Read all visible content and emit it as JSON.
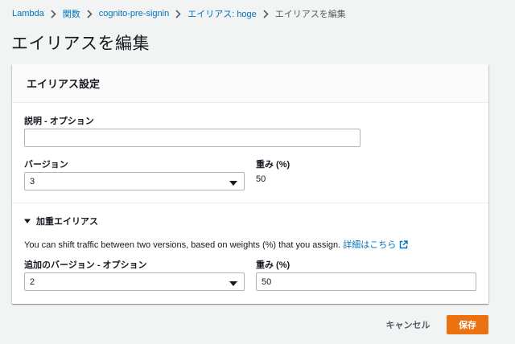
{
  "breadcrumb": {
    "items": [
      "Lambda",
      "関数",
      "cognito-pre-signin",
      "エイリアス: hoge"
    ],
    "current": "エイリアスを編集"
  },
  "page": {
    "title": "エイリアスを編集"
  },
  "panel": {
    "title": "エイリアス設定",
    "description": {
      "label": "説明 - オプション",
      "value": ""
    },
    "version": {
      "label": "バージョン",
      "selected": "3"
    },
    "weight": {
      "label": "重み (%)",
      "value": "50"
    },
    "weighted": {
      "toggle_label": "加重エイリアス",
      "help_text": "You can shift traffic between two versions, based on weights (%) that you assign.",
      "help_link": "詳細はこちら",
      "extra_version": {
        "label": "追加のバージョン - オプション",
        "selected": "2"
      },
      "extra_weight": {
        "label": "重み (%)",
        "value": "50"
      }
    }
  },
  "footer": {
    "cancel_label": "キャンセル",
    "save_label": "保存"
  },
  "colors": {
    "link": "#0073bb",
    "primary": "#ec7211",
    "background": "#f2f3f3"
  },
  "icons": [
    "chevron-right-icon",
    "caret-down-icon",
    "triangle-down-icon",
    "external-link-icon"
  ]
}
